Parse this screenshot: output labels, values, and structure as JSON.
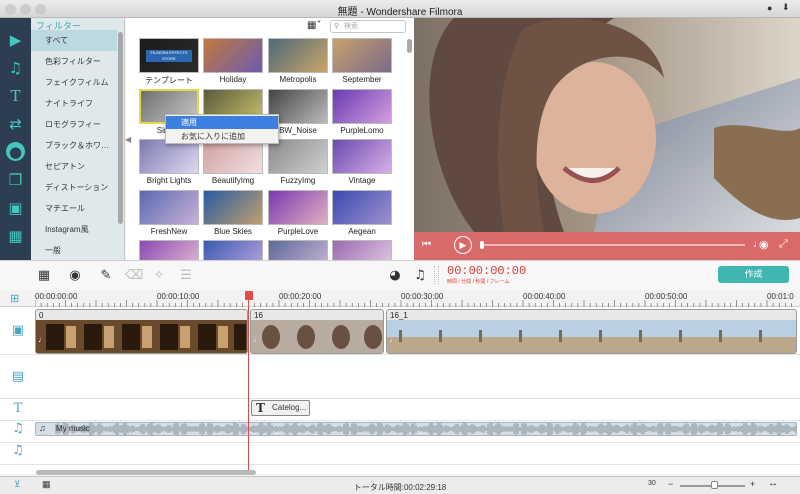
{
  "window": {
    "title": "無題 - Wondershare Filmora"
  },
  "filter_panel": {
    "header": "フィルター",
    "search_placeholder": "検索",
    "categories": [
      "すべて",
      "色彩フィルター",
      "フェイクフィルム",
      "ナイトライフ",
      "ロモグラフィー",
      "ブラック＆ホワ…",
      "セピアトン",
      "ディストーション",
      "マチエール",
      "Instagram風",
      "一般"
    ],
    "selected_category": "すべて",
    "filters": [
      {
        "label": "テンプレート",
        "c1": "#1b1b1b",
        "c2": "#2b2b2b"
      },
      {
        "label": "Holiday",
        "c1": "#c07a3c",
        "c2": "#6d5bb0"
      },
      {
        "label": "Metropolis",
        "c1": "#4e6a7a",
        "c2": "#c9a46a"
      },
      {
        "label": "September",
        "c1": "#c8a26a",
        "c2": "#7a6a8a"
      },
      {
        "label": "Simple",
        "c1": "#707070",
        "c2": "#c8c8c8"
      },
      {
        "label": "",
        "c1": "#5a5a3a",
        "c2": "#c8c070"
      },
      {
        "label": "BW_Noise",
        "c1": "#444",
        "c2": "#bbb"
      },
      {
        "label": "PurpleLomo",
        "c1": "#6a3ab0",
        "c2": "#d3a0e0"
      },
      {
        "label": "Bright Lights",
        "c1": "#7a7ab0",
        "c2": "#e0d8f0"
      },
      {
        "label": "BeautifyImg",
        "c1": "#d0a0a0",
        "c2": "#f0e0e0"
      },
      {
        "label": "FuzzyImg",
        "c1": "#8a8a8a",
        "c2": "#d0d0d0"
      },
      {
        "label": "Vintage",
        "c1": "#6a4ab0",
        "c2": "#d8b0e8"
      },
      {
        "label": "FreshNew",
        "c1": "#5a6ab0",
        "c2": "#c8b0d8"
      },
      {
        "label": "Blue Skies",
        "c1": "#2a5aa0",
        "c2": "#c0a070"
      },
      {
        "label": "PurpleLove",
        "c1": "#7a3ab0",
        "c2": "#e0b0c0"
      },
      {
        "label": "Aegean",
        "c1": "#3a4ab0",
        "c2": "#a090d0"
      },
      {
        "label": "",
        "c1": "#8a4ab0",
        "c2": "#e8c0d8"
      },
      {
        "label": "",
        "c1": "#3a5ab0",
        "c2": "#c0a8e0"
      },
      {
        "label": "",
        "c1": "#5a6a9a",
        "c2": "#d0b8d8"
      },
      {
        "label": "",
        "c1": "#9a6ab0",
        "c2": "#e8d0e8"
      }
    ],
    "template_badge": "FILMORA EFFECTS STORE"
  },
  "context_menu": {
    "items": [
      "適用",
      "お気に入りに追加"
    ]
  },
  "toolbar": {
    "timecode": "00:00:00:00",
    "timecode_labels": "時間 / 分間 / 秒間 / フレーム",
    "export_label": "作成"
  },
  "ruler": {
    "ticks": [
      "00:00:00:00",
      "00:00:10:00",
      "00:00:20:00",
      "00:00:30:00",
      "00:00:40:00",
      "00:00:50:00",
      "00:01:0"
    ]
  },
  "timeline": {
    "clips": [
      {
        "name": "0"
      },
      {
        "name": "16"
      },
      {
        "name": "16_1"
      }
    ],
    "title_clip": "Catelog...",
    "music_clip": "My music"
  },
  "status": {
    "total_time": "トータル時間:00:02:29:18",
    "fps": "30"
  }
}
